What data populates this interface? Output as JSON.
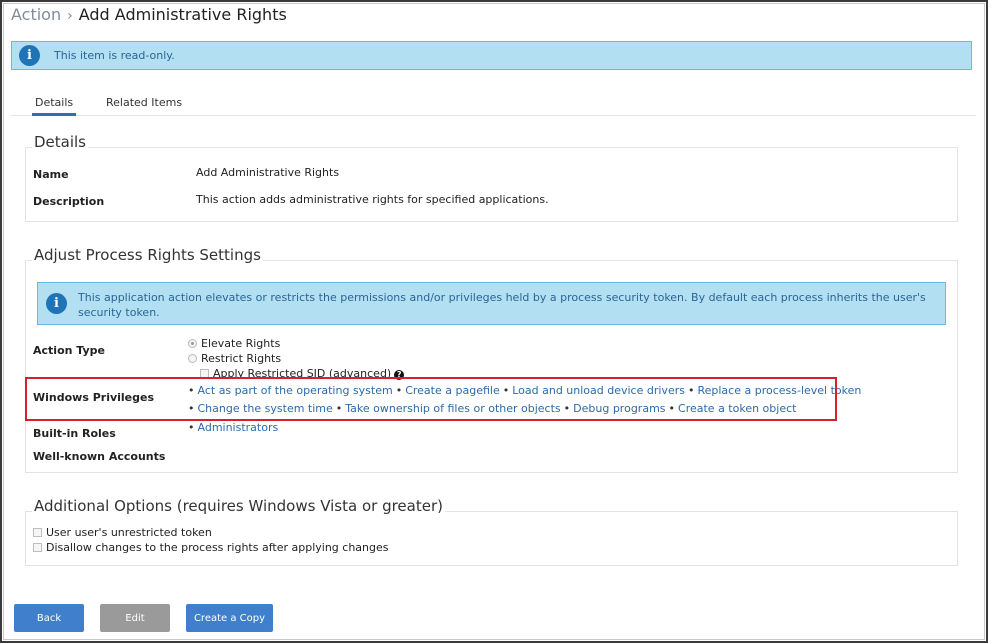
{
  "breadcrumb": {
    "parent": "Action",
    "separator": "›",
    "current": "Add Administrative Rights"
  },
  "readonly_banner": {
    "message": "This item is read-only."
  },
  "tabs": [
    {
      "label": "Details",
      "active": true
    },
    {
      "label": "Related Items",
      "active": false
    }
  ],
  "details": {
    "title": "Details",
    "name_label": "Name",
    "name_value": "Add Administrative Rights",
    "description_label": "Description",
    "description_value": "This action adds administrative rights for specified applications."
  },
  "adjust": {
    "title": "Adjust Process Rights Settings",
    "banner_message": "This application action elevates or restricts the permissions and/or privileges held by a process security token. By default each process inherits the user's security token.",
    "action_type_label": "Action Type",
    "elevate_label": "Elevate Rights",
    "restrict_label": "Restrict Rights",
    "restricted_sid_label": "Apply Restricted SID (advanced)",
    "action_type_selected": "Elevate Rights",
    "privileges_label": "Windows Privileges",
    "privileges_row1": [
      "Act as part of the operating system",
      "Create a pagefile",
      "Load and unload device drivers",
      "Replace a process-level token"
    ],
    "privileges_row2": [
      "Change the system time",
      "Take ownership of files or other objects",
      "Debug programs",
      "Create a token object"
    ],
    "roles_label": "Built-in Roles",
    "roles": [
      "Administrators"
    ],
    "accounts_label": "Well-known Accounts"
  },
  "additional": {
    "title": "Additional Options (requires Windows Vista or greater)",
    "option1": "User user's unrestricted token",
    "option2": "Disallow changes to the process rights after applying changes"
  },
  "buttons": {
    "back": "Back",
    "edit": "Edit",
    "copy": "Create a Copy"
  },
  "colors": {
    "accent": "#3f7fcc",
    "info_bg": "#b3dff2",
    "highlight": "#d9202a",
    "link": "#2d6aa8"
  }
}
